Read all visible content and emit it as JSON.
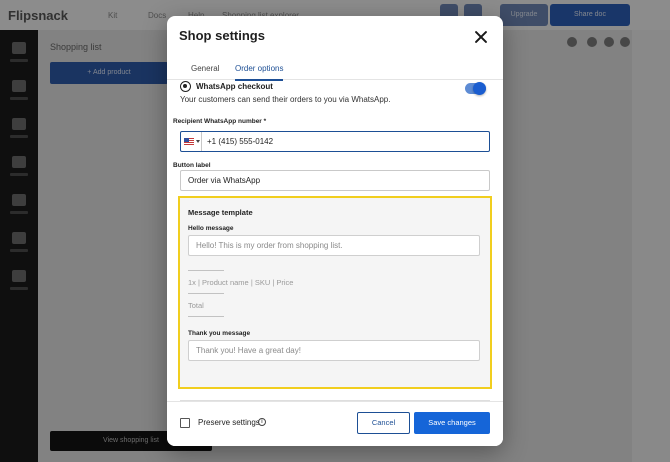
{
  "app": {
    "logo": "Flipsnack"
  },
  "background": {
    "nav_items": [
      "Kit",
      "Docs",
      "Help",
      "Shopping list explorer"
    ],
    "upgrade_label": "Upgrade",
    "share_label": "Share doc",
    "list_title": "Shopping list",
    "add_label": "+ Add product",
    "view_label": "View shopping list"
  },
  "modal": {
    "title": "Shop settings",
    "close_icon": "close-icon",
    "tabs": [
      {
        "label": "General",
        "active": false
      },
      {
        "label": "Order options",
        "active": true
      }
    ],
    "whatsapp": {
      "icon": "whatsapp-icon",
      "title": "WhatsApp checkout",
      "description": "Your customers can send their orders to you via WhatsApp.",
      "enabled": true
    },
    "recipient": {
      "label": "Recipient WhatsApp number *",
      "country_flag": "us-flag-icon",
      "value": "+1 (415) 555-0142"
    },
    "button_label": {
      "label": "Button label",
      "value": "Order via WhatsApp"
    },
    "template": {
      "title": "Message template",
      "hello_label": "Hello message",
      "hello_placeholder": "Hello! This is my order from shopping list.",
      "line_item": "1x | Product name | SKU | Price",
      "total": "Total",
      "thanks_label": "Thank you message",
      "thanks_placeholder": "Thank you! Have a great day!"
    },
    "footer": {
      "preserve_label": "Preserve settings",
      "preserve_checked": false,
      "info_icon": "info-icon",
      "cancel_label": "Cancel",
      "save_label": "Save changes"
    }
  },
  "colors": {
    "primary": "#1565d8",
    "tab_active": "#1d4f95",
    "highlight_border": "#f1ce1e"
  }
}
